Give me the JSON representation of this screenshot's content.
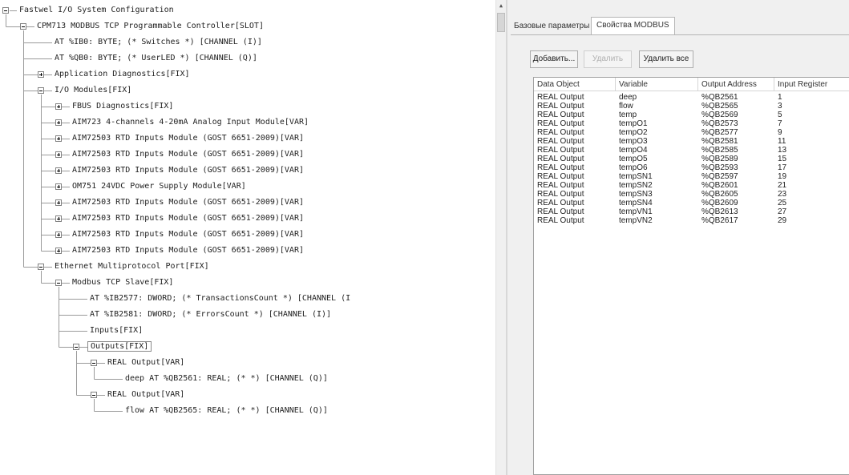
{
  "tree": {
    "rows": [
      {
        "label": "Fastwel I/O System Configuration",
        "level": 0,
        "expander": "minus"
      },
      {
        "label": "CPM713 MODBUS TCP Programmable Controller[SLOT]",
        "level": 1,
        "expander": "minus"
      },
      {
        "label": "AT %IB0: BYTE; (* Switches *) [CHANNEL (I)]",
        "level": 2,
        "expander": "none"
      },
      {
        "label": "AT %QB0: BYTE; (* UserLED *) [CHANNEL (Q)]",
        "level": 2,
        "expander": "none"
      },
      {
        "label": "Application Diagnostics[FIX]",
        "level": 2,
        "expander": "plus"
      },
      {
        "label": "I/O Modules[FIX]",
        "level": 2,
        "expander": "minus"
      },
      {
        "label": "FBUS Diagnostics[FIX]",
        "level": 3,
        "expander": "plus"
      },
      {
        "label": "AIM723 4-channels 4-20mA Analog Input Module[VAR]",
        "level": 3,
        "expander": "plus"
      },
      {
        "label": "AIM72503 RTD Inputs Module (GOST 6651-2009)[VAR]",
        "level": 3,
        "expander": "plus"
      },
      {
        "label": "AIM72503 RTD Inputs Module (GOST 6651-2009)[VAR]",
        "level": 3,
        "expander": "plus"
      },
      {
        "label": "AIM72503 RTD Inputs Module (GOST 6651-2009)[VAR]",
        "level": 3,
        "expander": "plus"
      },
      {
        "label": "OM751 24VDC Power Supply Module[VAR]",
        "level": 3,
        "expander": "plus"
      },
      {
        "label": "AIM72503 RTD Inputs Module (GOST 6651-2009)[VAR]",
        "level": 3,
        "expander": "plus"
      },
      {
        "label": "AIM72503 RTD Inputs Module (GOST 6651-2009)[VAR]",
        "level": 3,
        "expander": "plus"
      },
      {
        "label": "AIM72503 RTD Inputs Module (GOST 6651-2009)[VAR]",
        "level": 3,
        "expander": "plus"
      },
      {
        "label": "AIM72503 RTD Inputs Module (GOST 6651-2009)[VAR]",
        "level": 3,
        "expander": "plus"
      },
      {
        "label": "Ethernet Multiprotocol Port[FIX]",
        "level": 2,
        "expander": "minus"
      },
      {
        "label": "Modbus TCP Slave[FIX]",
        "level": 3,
        "expander": "minus"
      },
      {
        "label": "AT %IB2577: DWORD; (* TransactionsCount *) [CHANNEL (I",
        "level": 4,
        "expander": "none"
      },
      {
        "label": "AT %IB2581: DWORD; (* ErrorsCount *) [CHANNEL (I)]",
        "level": 4,
        "expander": "none"
      },
      {
        "label": "Inputs[FIX]",
        "level": 4,
        "expander": "none"
      },
      {
        "label": "Outputs[FIX]",
        "level": 4,
        "expander": "minus",
        "selected": true
      },
      {
        "label": "REAL Output[VAR]",
        "level": 5,
        "expander": "minus"
      },
      {
        "label": "deep AT %QB2561: REAL; (*  *) [CHANNEL (Q)]",
        "level": 6,
        "expander": "none"
      },
      {
        "label": "REAL Output[VAR]",
        "level": 5,
        "expander": "minus"
      },
      {
        "label": "flow AT %QB2565: REAL; (*  *) [CHANNEL (Q)]",
        "level": 6,
        "expander": "none"
      }
    ]
  },
  "tabs": [
    {
      "label": "Базовые параметры",
      "active": false
    },
    {
      "label": "Свойства MODBUS",
      "active": true
    }
  ],
  "buttons": {
    "add": "Добавить...",
    "remove": "Удалить",
    "remove_all": "Удалить все"
  },
  "grid": {
    "columns": [
      "Data Object",
      "Variable",
      "Output Address",
      "Input Register"
    ],
    "rows": [
      [
        "REAL Output",
        "deep",
        "%QB2561",
        "1"
      ],
      [
        "REAL Output",
        "flow",
        "%QB2565",
        "3"
      ],
      [
        "REAL Output",
        "temp",
        "%QB2569",
        "5"
      ],
      [
        "REAL Output",
        "tempO1",
        "%QB2573",
        "7"
      ],
      [
        "REAL Output",
        "tempO2",
        "%QB2577",
        "9"
      ],
      [
        "REAL Output",
        "tempO3",
        "%QB2581",
        "11"
      ],
      [
        "REAL Output",
        "tempO4",
        "%QB2585",
        "13"
      ],
      [
        "REAL Output",
        "tempO5",
        "%QB2589",
        "15"
      ],
      [
        "REAL Output",
        "tempO6",
        "%QB2593",
        "17"
      ],
      [
        "REAL Output",
        "tempSN1",
        "%QB2597",
        "19"
      ],
      [
        "REAL Output",
        "tempSN2",
        "%QB2601",
        "21"
      ],
      [
        "REAL Output",
        "tempSN3",
        "%QB2605",
        "23"
      ],
      [
        "REAL Output",
        "tempSN4",
        "%QB2609",
        "25"
      ],
      [
        "REAL Output",
        "tempVN1",
        "%QB2613",
        "27"
      ],
      [
        "REAL Output",
        "tempVN2",
        "%QB2617",
        "29"
      ]
    ]
  },
  "scrollbar": {
    "up_glyph": "▲"
  }
}
